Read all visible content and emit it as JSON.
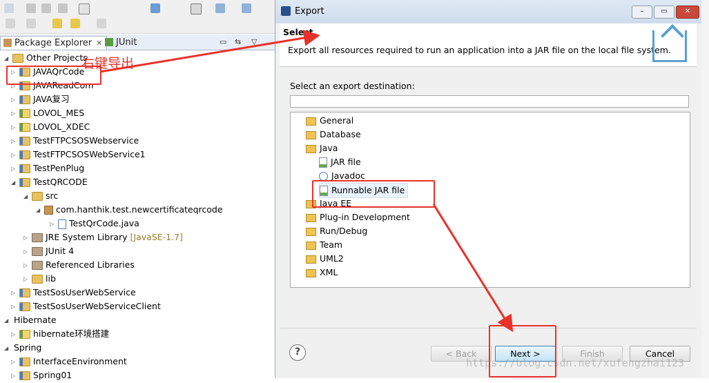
{
  "workbench": {
    "tabs": [
      {
        "label": "Package Explorer",
        "close": "✕"
      },
      {
        "label": "JUnit"
      }
    ],
    "tree": [
      {
        "label": "Other Projects",
        "type": "folder",
        "level": 0,
        "expanded": true
      },
      {
        "label": "JAVAQrCode",
        "type": "project",
        "level": 1,
        "expanded": false
      },
      {
        "label": "JAVAReadCom",
        "type": "project",
        "level": 1,
        "expanded": false
      },
      {
        "label": "JAVA复习",
        "type": "project",
        "level": 1,
        "expanded": false
      },
      {
        "label": "LOVOL_MES",
        "type": "ws",
        "level": 1,
        "expanded": false
      },
      {
        "label": "LOVOL_XDEC",
        "type": "ws",
        "level": 1,
        "expanded": false
      },
      {
        "label": "TestFTPCSOSWebservice",
        "type": "project",
        "level": 1,
        "expanded": false
      },
      {
        "label": "TestFTPCSOSWebService1",
        "type": "project",
        "level": 1,
        "expanded": false
      },
      {
        "label": "TestPenPlug",
        "type": "project",
        "level": 1,
        "expanded": false
      },
      {
        "label": "TestQRCODE",
        "type": "project",
        "level": 1,
        "expanded": true
      },
      {
        "label": "src",
        "type": "folder",
        "level": 2,
        "expanded": true
      },
      {
        "label": "com.hanthik.test.newcertificateqrcode",
        "type": "pkg",
        "level": 3,
        "expanded": true
      },
      {
        "label": "TestQrCode.java",
        "type": "java",
        "level": 4,
        "expanded": false
      },
      {
        "label": "JRE System Library",
        "suffix": "[JavaSE-1.7]",
        "type": "lib",
        "level": 2,
        "expanded": false
      },
      {
        "label": "JUnit 4",
        "type": "lib",
        "level": 2,
        "expanded": false
      },
      {
        "label": "Referenced Libraries",
        "type": "lib",
        "level": 2,
        "expanded": false
      },
      {
        "label": "lib",
        "type": "folder",
        "level": 2,
        "expanded": false
      },
      {
        "label": "TestSosUserWebService",
        "type": "project",
        "level": 1,
        "expanded": false
      },
      {
        "label": "TestSosUserWebServiceClient",
        "type": "project",
        "level": 1,
        "expanded": false
      },
      {
        "label": "Hibernate",
        "type": "none",
        "level": 0,
        "expanded": true
      },
      {
        "label": "hibernate环境搭建",
        "type": "ws",
        "level": 1,
        "expanded": false
      },
      {
        "label": "Spring",
        "type": "none",
        "level": 0,
        "expanded": true
      },
      {
        "label": "InterfaceEnvironment",
        "type": "project",
        "level": 1,
        "expanded": false
      },
      {
        "label": "Spring01",
        "type": "project",
        "level": 1,
        "expanded": false
      }
    ]
  },
  "annotation": {
    "text": "右键导出",
    "color": "#e8312a"
  },
  "dialog": {
    "title": "Export",
    "win_buttons": {
      "minimize": "–",
      "maximize": "▭",
      "close": "✕"
    },
    "banner_title": "Select",
    "banner_desc": "Export all resources required to run an application into a JAR file on the local file system.",
    "dest_label": "Select an export destination:",
    "filter_value": "",
    "tree": [
      {
        "label": "General",
        "type": "folder",
        "level": 0
      },
      {
        "label": "Database",
        "type": "folder",
        "level": 0
      },
      {
        "label": "Java",
        "type": "folder",
        "level": 0
      },
      {
        "label": "JAR file",
        "type": "jar",
        "level": 1
      },
      {
        "label": "Javadoc",
        "type": "doc",
        "level": 1
      },
      {
        "label": "Runnable JAR file",
        "type": "jar",
        "level": 1,
        "selected": true
      },
      {
        "label": "Java EE",
        "type": "folder",
        "level": 0
      },
      {
        "label": "Plug-in Development",
        "type": "folder",
        "level": 0
      },
      {
        "label": "Run/Debug",
        "type": "folder",
        "level": 0
      },
      {
        "label": "Team",
        "type": "folder",
        "level": 0
      },
      {
        "label": "UML2",
        "type": "folder",
        "level": 0
      },
      {
        "label": "XML",
        "type": "folder",
        "level": 0
      }
    ],
    "buttons": {
      "help": "?",
      "back": "< Back",
      "next": "Next >",
      "finish": "Finish",
      "cancel": "Cancel"
    },
    "watermark": "https://blog.csdn.net/xufengzhai123"
  },
  "colors": {
    "accent_red": "#e8312a",
    "banner_icon": "#5aa0d4",
    "selection": "#eaf2fb"
  }
}
